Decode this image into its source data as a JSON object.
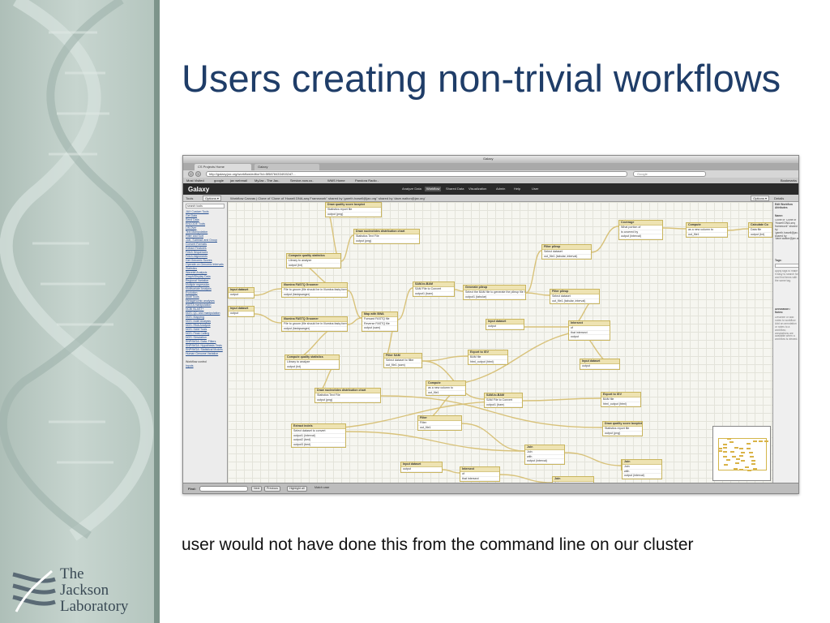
{
  "slide": {
    "title": "Users creating non-trivial workflows",
    "caption": "user would not have done this from the command line on our cluster",
    "logo_lines": [
      "The",
      "Jackson",
      "Laboratory"
    ]
  },
  "browser": {
    "window_title": "Galaxy",
    "tab1": "CS Projects Home",
    "tab2": "Galaxy",
    "url": "http://galaxy.jax.org/workflow/editor?id=5f58784334f152d7...",
    "search_placeholder": "Google",
    "bookmarks": [
      "Most Visited",
      "google",
      "jax webmail",
      "MyJax - The Jac..",
      "Service-now.co..",
      "WMS Home",
      "Pandora Radio -"
    ],
    "bookmarks_right": "Bookmarks"
  },
  "galaxy": {
    "logo": "Galaxy",
    "nav": [
      "Analyze Data",
      "Workflow",
      "Shared Data",
      "Visualization",
      "Admin",
      "Help",
      "User"
    ],
    "active_nav": "Workflow"
  },
  "tools": {
    "header": "Tools",
    "options": "Options ▾",
    "search_placeholder": "search tools",
    "items": [
      "JAX Custom Tools",
      "Get Data",
      "Send Data",
      "ENCODE Tools",
      "Lift-Over",
      "Text Manipulation",
      "Filter and Sort",
      "Join, Subtract and Group",
      "Convert Formats",
      "Extract Features",
      "Fetch Sequences",
      "Fetch Alignments",
      "Get Genomic Scores",
      "Operate on Genomic Intervals",
      "Statistics",
      "Wavelet Analysis",
      "Graph/Display Data",
      "Regional Variation",
      "Multiple regression",
      "Multivariate Analysis",
      "Evolution",
      "Motif Tools",
      "Metagenomic analyses",
      "FASTA manipulation",
      "NCBI BLAST+",
      "NGS: QC and manipulation",
      "NGS: Mapping",
      "NGS: Indel Analysis",
      "NGS: RNA Analysis",
      "NGS: SAM Tools",
      "NGS: Peak Calling",
      "NGS: Simulation",
      "SNP/WGA: Data; Filters",
      "SNP/WGA: Hypothesis Tests",
      "SNP/WGA: Statistical Models",
      "Human Genome Variation",
      "",
      "Workflow control",
      "Inputs"
    ]
  },
  "canvas": {
    "header": "Workflow Canvas | Clone of 'Clone of 'Howell DNA-seq Framework'' shared by 'gareth.howell@jax.org'' shared by 'dave.walton@jax.org'",
    "options": "Options ▾"
  },
  "nodes": [
    {
      "title": "Draw quality score boxplot",
      "rows": [
        "Statistics report file",
        "output (png)"
      ]
    },
    {
      "title": "Draw nucleotides distribution chart",
      "rows": [
        "Statistics Text File",
        "output (png)"
      ]
    },
    {
      "title": "Compute quality statistics",
      "rows": [
        "Library to analyze",
        "output (txt)"
      ]
    },
    {
      "title": "Input dataset",
      "rows": [
        "output"
      ]
    },
    {
      "title": "Input dataset",
      "rows": [
        "output"
      ]
    },
    {
      "title": "Illumina FASTQ Groomer",
      "rows": [
        "File to groom (file should be in Illumina fastq format)",
        "output (fastqsanger)"
      ]
    },
    {
      "title": "Illumina FASTQ Groomer",
      "rows": [
        "File to groom (file should be in Illumina fastq format)",
        "output (fastqsanger)"
      ]
    },
    {
      "title": "Map with BWA",
      "rows": [
        "Forward FASTQ file",
        "Reverse FASTQ file",
        "output (sam)"
      ]
    },
    {
      "title": "SAM-to-BAM",
      "rows": [
        "SAM File to Convert",
        "output1 (bam)"
      ]
    },
    {
      "title": "Generate pileup",
      "rows": [
        "Select the BAM file to generate the pileup file for",
        "output1 (tabular)"
      ]
    },
    {
      "title": "Filter pileup",
      "rows": [
        "Select dataset",
        "out_file1 (tabular, interval)"
      ]
    },
    {
      "title": "Input dataset",
      "rows": [
        "output"
      ]
    },
    {
      "title": "Filter pileup",
      "rows": [
        "Select dataset",
        "out_file1 (tabular, interval)"
      ]
    },
    {
      "title": "Coverage",
      "rows": [
        "What portion of",
        "is covered by",
        "output (interval)"
      ]
    },
    {
      "title": "Compute",
      "rows": [
        "as a new column to",
        "out_file1"
      ]
    },
    {
      "title": "Calculate Co",
      "rows": [
        "Data file",
        "output (txt)"
      ]
    },
    {
      "title": "Compute quality statistics",
      "rows": [
        "Library to analyze",
        "output (txt)"
      ]
    },
    {
      "title": "Filter SAM",
      "rows": [
        "Select dataset to filter",
        "out_file1 (sam)"
      ]
    },
    {
      "title": "Export to IGV",
      "rows": [
        "BAM file",
        "html_output (html)"
      ]
    },
    {
      "title": "Input dataset",
      "rows": [
        "output"
      ]
    },
    {
      "title": "Intersect",
      "rows": [
        "of",
        "that intersect",
        "output"
      ]
    },
    {
      "title": "Compute",
      "rows": [
        "as a new column to",
        "out_file1"
      ]
    },
    {
      "title": "Draw nucleotides distribution chart",
      "rows": [
        "Statistics Text File",
        "output (png)"
      ]
    },
    {
      "title": "SAM-to-BAM",
      "rows": [
        "SAM File to Convert",
        "output1 (bam)"
      ]
    },
    {
      "title": "Export to IGV",
      "rows": [
        "BAM file",
        "html_output (html)"
      ]
    },
    {
      "title": "Filter",
      "rows": [
        "Filter",
        "out_file1"
      ]
    },
    {
      "title": "Extract indels",
      "rows": [
        "Select dataset to convert",
        "output1 (interval)",
        "output2 (bed)",
        "output3 (bed)"
      ]
    },
    {
      "title": "Draw quality score boxplot",
      "rows": [
        "Statistics report file",
        "output (png)"
      ]
    },
    {
      "title": "Join",
      "rows": [
        "Join",
        "with",
        "output (interval)"
      ]
    },
    {
      "title": "Input dataset",
      "rows": [
        "output"
      ]
    },
    {
      "title": "Intersect",
      "rows": [
        "of",
        "that intersect"
      ]
    },
    {
      "title": "Join",
      "rows": [
        "Join"
      ]
    },
    {
      "title": "Input dataset",
      "rows": [
        "output"
      ]
    },
    {
      "title": "Join",
      "rows": [
        "Join",
        "with",
        "output (interval)"
      ]
    }
  ],
  "details": {
    "header": "Details",
    "title": "Edit Workflow Attributes",
    "name_label": "Name:",
    "name_value": "Clone of 'Clone of 'Howell DNA-seq framework'' shared by 'gareth.howell@jax.org'' shared by 'dave.walton@jax.org'",
    "tags_label": "Tags:",
    "tags_help": "Apply tags to make it easy to search for and find items with the same tag.",
    "annotation_label": "Annotation / Notes:",
    "annotation_help": "Describe or add notes to workflow Add an annotation or notes to a workflow; annotations are available when a workflow is viewed."
  },
  "findbar": {
    "label": "Find:",
    "next": "Next",
    "previous": "Previous",
    "highlight": "Highlight all",
    "match_case": "Match case"
  }
}
